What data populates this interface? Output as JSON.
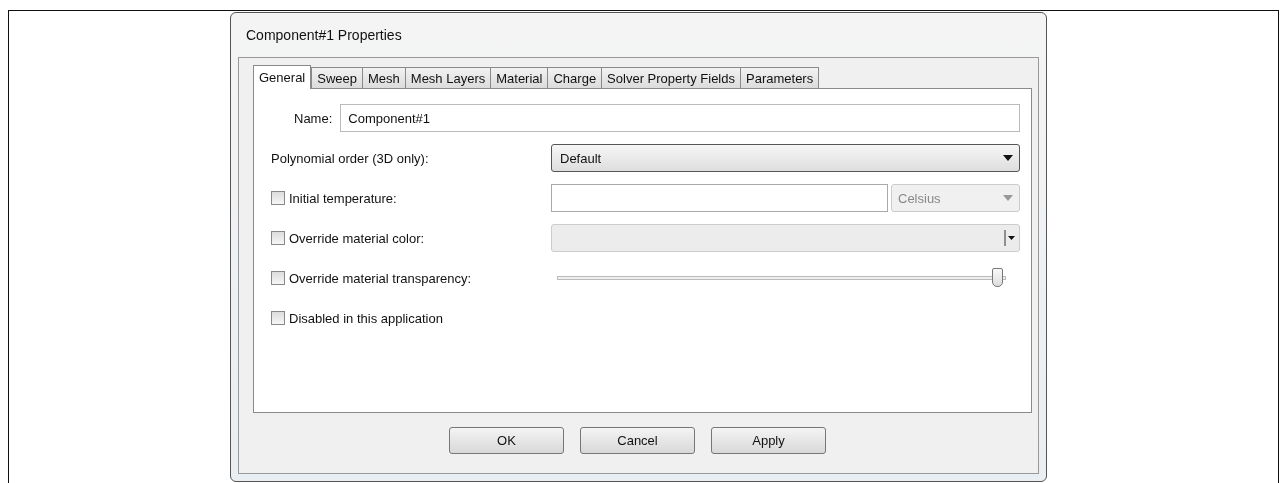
{
  "window": {
    "title": "Component#1 Properties"
  },
  "tabs": [
    {
      "label": "General",
      "selected": true
    },
    {
      "label": "Sweep",
      "selected": false
    },
    {
      "label": "Mesh",
      "selected": false
    },
    {
      "label": "Mesh Layers",
      "selected": false
    },
    {
      "label": "Material",
      "selected": false
    },
    {
      "label": "Charge",
      "selected": false
    },
    {
      "label": "Solver Property Fields",
      "selected": false
    },
    {
      "label": "Parameters",
      "selected": false
    }
  ],
  "name_field": {
    "label": "Name:",
    "value": "Component#1"
  },
  "polynomial_order": {
    "label": "Polynomial order (3D only):",
    "value": "Default"
  },
  "options": [
    {
      "kind": "temperature",
      "label": "Initial temperature:",
      "checked": false,
      "unit": "Celsius",
      "disabled": true
    },
    {
      "kind": "color",
      "label": "Override material color:",
      "checked": false,
      "disabled": true
    },
    {
      "kind": "slider",
      "label": "Override material transparency:",
      "checked": false,
      "level": 0.98
    },
    {
      "kind": "plain",
      "label": "Disabled in this application",
      "checked": false
    }
  ],
  "buttons": [
    "OK",
    "Cancel",
    "Apply"
  ]
}
